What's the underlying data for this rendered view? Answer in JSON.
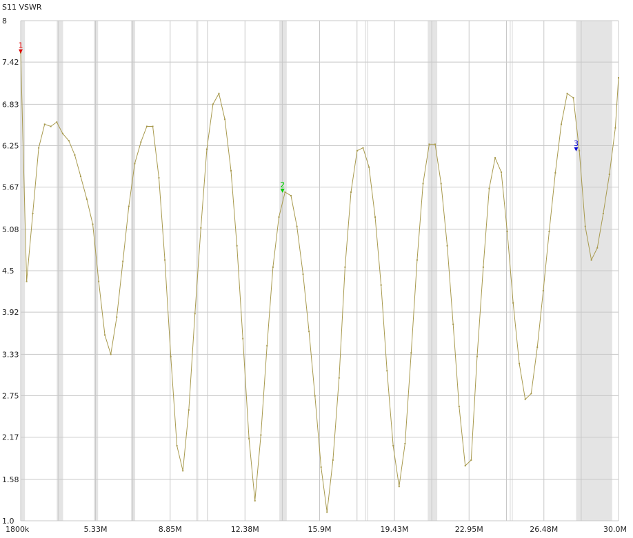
{
  "chart_data": {
    "type": "line",
    "title": "S11 VSWR",
    "xlabel": "",
    "ylabel": "",
    "x_unit": "MHz",
    "xlim": [
      1.8,
      30.0
    ],
    "ylim": [
      1.0,
      8.0
    ],
    "x_ticks": [
      {
        "value": 1.8,
        "label": "1800k"
      },
      {
        "value": 5.33,
        "label": "5.33M"
      },
      {
        "value": 8.85,
        "label": "8.85M"
      },
      {
        "value": 12.38,
        "label": "12.38M"
      },
      {
        "value": 15.9,
        "label": "15.9M"
      },
      {
        "value": 19.43,
        "label": "19.43M"
      },
      {
        "value": 22.95,
        "label": "22.95M"
      },
      {
        "value": 26.48,
        "label": "26.48M"
      },
      {
        "value": 30.0,
        "label": "30.0M"
      }
    ],
    "y_ticks": [
      {
        "value": 8.0,
        "label": "8"
      },
      {
        "value": 7.42,
        "label": "7.42"
      },
      {
        "value": 6.83,
        "label": "6.83"
      },
      {
        "value": 6.25,
        "label": "6.25"
      },
      {
        "value": 5.67,
        "label": "5.67"
      },
      {
        "value": 5.08,
        "label": "5.08"
      },
      {
        "value": 4.5,
        "label": "4.5"
      },
      {
        "value": 3.92,
        "label": "3.92"
      },
      {
        "value": 3.33,
        "label": "3.33"
      },
      {
        "value": 2.75,
        "label": "2.75"
      },
      {
        "value": 2.17,
        "label": "2.17"
      },
      {
        "value": 1.58,
        "label": "1.58"
      },
      {
        "value": 1.0,
        "label": "1.0"
      }
    ],
    "grid": true,
    "bands_mhz": [
      [
        1.8,
        2.0
      ],
      [
        3.5,
        3.8
      ],
      [
        5.25,
        5.45
      ],
      [
        7.0,
        7.2
      ],
      [
        14.0,
        14.35
      ],
      [
        21.0,
        21.45
      ],
      [
        28.0,
        29.7
      ]
    ],
    "minor_verticals_mhz": [
      10.1,
      10.15,
      18.068,
      18.168,
      24.89,
      24.99
    ],
    "series": [
      {
        "color": "#a89a4e",
        "x": [
          1.8,
          2.08,
          2.37,
          2.65,
          2.93,
          3.22,
          3.5,
          3.78,
          4.07,
          4.35,
          4.63,
          4.92,
          5.2,
          5.48,
          5.77,
          6.05,
          6.33,
          6.62,
          6.9,
          7.18,
          7.47,
          7.75,
          8.03,
          8.32,
          8.6,
          8.88,
          9.17,
          9.45,
          9.73,
          10.02,
          10.3,
          10.58,
          10.87,
          11.15,
          11.43,
          11.72,
          12.0,
          12.28,
          12.57,
          12.85,
          13.13,
          13.42,
          13.7,
          13.98,
          14.27,
          14.55,
          14.83,
          15.12,
          15.4,
          15.68,
          15.97,
          16.25,
          16.53,
          16.82,
          17.1,
          17.38,
          17.67,
          17.95,
          18.23,
          18.52,
          18.8,
          19.08,
          19.37,
          19.65,
          19.93,
          20.22,
          20.5,
          20.78,
          21.07,
          21.35,
          21.63,
          21.92,
          22.2,
          22.48,
          22.77,
          23.05,
          23.33,
          23.62,
          23.9,
          24.18,
          24.47,
          24.75,
          25.03,
          25.32,
          25.6,
          25.88,
          26.17,
          26.45,
          26.73,
          27.02,
          27.3,
          27.58,
          27.87,
          28.15,
          28.43,
          28.72,
          29.0,
          29.28,
          29.57,
          29.85,
          30.0
        ],
        "y": [
          7.55,
          4.35,
          5.3,
          6.22,
          6.55,
          6.52,
          6.58,
          6.42,
          6.32,
          6.12,
          5.82,
          5.5,
          5.15,
          4.35,
          3.6,
          3.33,
          3.85,
          4.63,
          5.4,
          6.0,
          6.3,
          6.52,
          6.52,
          5.8,
          4.65,
          3.3,
          2.05,
          1.7,
          2.55,
          3.9,
          5.1,
          6.2,
          6.83,
          6.98,
          6.62,
          5.9,
          4.85,
          3.55,
          2.15,
          1.28,
          2.2,
          3.45,
          4.55,
          5.25,
          5.6,
          5.55,
          5.12,
          4.45,
          3.65,
          2.75,
          1.75,
          1.12,
          1.85,
          3.0,
          4.55,
          5.6,
          6.18,
          6.22,
          5.95,
          5.25,
          4.3,
          3.1,
          2.05,
          1.48,
          2.08,
          3.35,
          4.65,
          5.72,
          6.27,
          6.27,
          5.72,
          4.85,
          3.75,
          2.6,
          1.77,
          1.85,
          3.3,
          4.55,
          5.65,
          6.08,
          5.88,
          5.05,
          4.05,
          3.2,
          2.7,
          2.78,
          3.43,
          4.22,
          5.05,
          5.87,
          6.55,
          6.98,
          6.92,
          6.18,
          5.12,
          4.65,
          4.82,
          5.3,
          5.85,
          6.5,
          7.2
        ]
      }
    ],
    "markers": [
      {
        "label": "1",
        "x": 1.8,
        "y": 7.55,
        "color": "#e00000"
      },
      {
        "label": "2",
        "x": 14.15,
        "y": 5.6,
        "color": "#00d000"
      },
      {
        "label": "3",
        "x": 28.0,
        "y": 6.18,
        "color": "#0000d0"
      }
    ]
  }
}
